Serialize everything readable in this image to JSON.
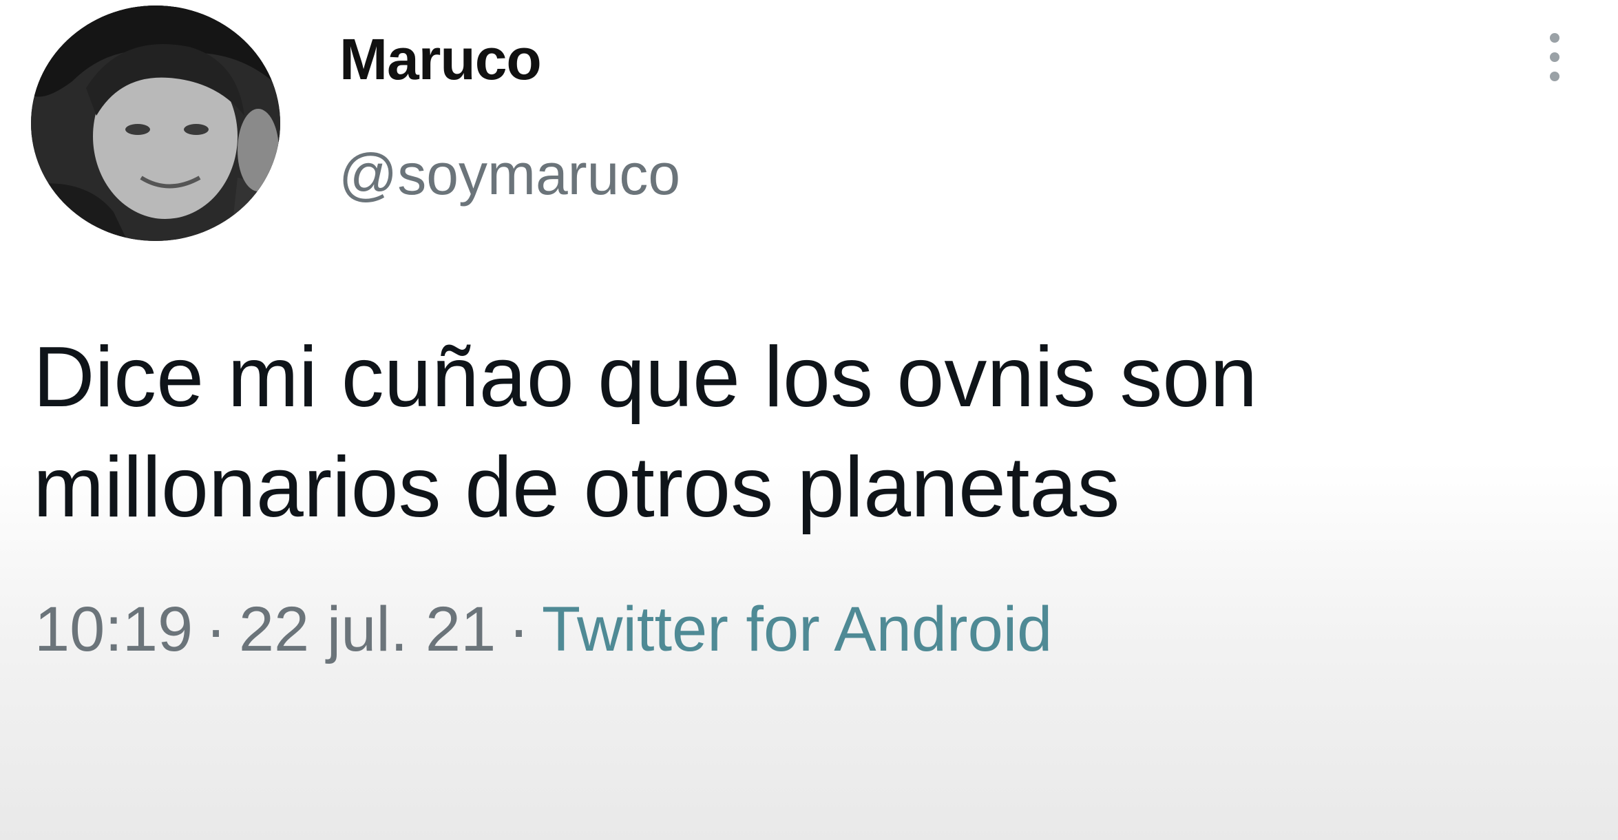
{
  "tweet": {
    "display_name": "Maruco",
    "handle": "@soymaruco",
    "text_lines": [
      "Dice mi cuñao que los ovnis son",
      "millonarios de otros planetas"
    ],
    "time": "10:19",
    "date": "22 jul. 21",
    "separator": "·",
    "source": "Twitter for Android"
  },
  "icons": {
    "more": "more-vertical-icon"
  },
  "colors": {
    "text": "#0f1419",
    "muted": "#6b747a",
    "source_link": "#4f8a95"
  }
}
